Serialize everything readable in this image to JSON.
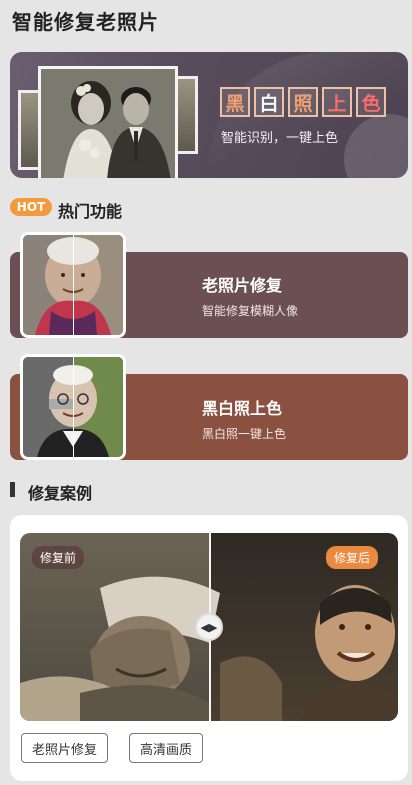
{
  "page": {
    "title": "智能修复老照片"
  },
  "banner": {
    "title_chars": [
      {
        "char": "黑",
        "color": "#f0a070"
      },
      {
        "char": "白",
        "color": "#f7f7f7"
      },
      {
        "char": "照",
        "color": "#f0a070"
      },
      {
        "char": "上",
        "color": "#ff6a6a"
      },
      {
        "char": "色",
        "color": "#ff6a6a"
      }
    ],
    "subtitle": "智能识别，一键上色"
  },
  "hot": {
    "badge": "HOT",
    "title": "热门功能",
    "features": [
      {
        "title": "老照片修复",
        "subtitle": "智能修复模糊人像"
      },
      {
        "title": "黑白照上色",
        "subtitle": "黑白照一键上色"
      }
    ]
  },
  "cases": {
    "title": "修复案例",
    "before_label": "修复前",
    "after_label": "修复后",
    "tags": [
      "老照片修复",
      "高清画质"
    ]
  },
  "colors": {
    "accent_orange": "#ea8a40",
    "hot_badge": "#f39a3c",
    "card_1": "#6c4f52",
    "card_2": "#8a5040"
  }
}
